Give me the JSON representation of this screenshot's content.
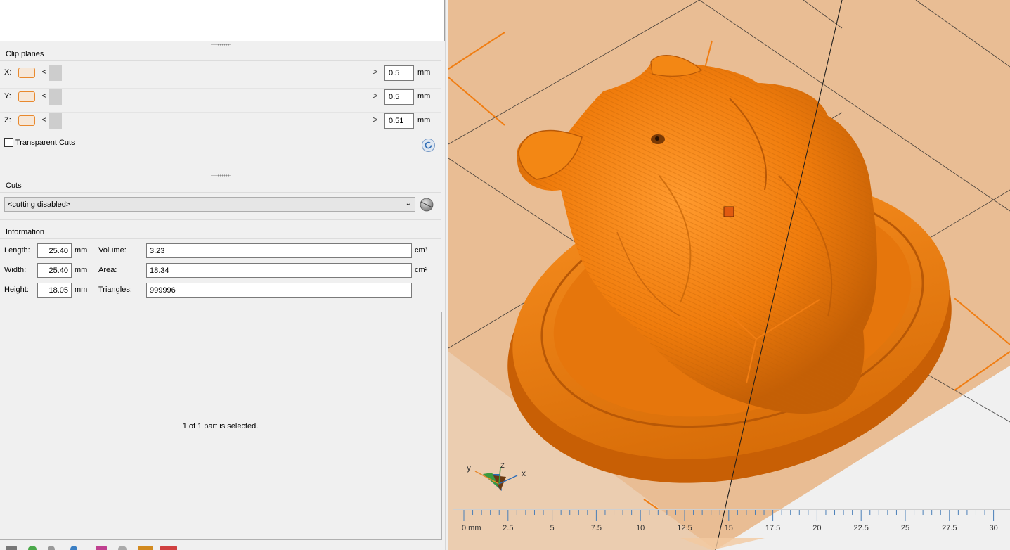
{
  "clip_planes": {
    "title": "Clip planes",
    "rows": [
      {
        "axis": "X:",
        "value": "0.5",
        "unit": "mm"
      },
      {
        "axis": "Y:",
        "value": "0.5",
        "unit": "mm"
      },
      {
        "axis": "Z:",
        "value": "0.51",
        "unit": "mm"
      }
    ],
    "arrow_left": "<",
    "arrow_right": ">",
    "transparent_cuts_label": "Transparent Cuts",
    "transparent_cuts_checked": false
  },
  "cuts": {
    "title": "Cuts",
    "selected": "<cutting disabled>"
  },
  "information": {
    "title": "Information",
    "length_label": "Length:",
    "length_value": "25.40",
    "length_unit": "mm",
    "width_label": "Width:",
    "width_value": "25.40",
    "width_unit": "mm",
    "height_label": "Height:",
    "height_value": "18.05",
    "height_unit": "mm",
    "volume_label": "Volume:",
    "volume_value": "3.23",
    "volume_unit": "cm³",
    "area_label": "Area:",
    "area_value": "18.34",
    "area_unit": "cm²",
    "triangles_label": "Triangles:",
    "triangles_value": "999996"
  },
  "status": {
    "selection_text": "1 of 1 part is selected."
  },
  "viewport": {
    "ruler_labels": [
      "0 mm",
      "2.5",
      "5",
      "7.5",
      "10",
      "12.5",
      "15",
      "17.5",
      "20",
      "22.5",
      "25",
      "27.5",
      "30"
    ],
    "axis_labels": {
      "x": "x",
      "y": "y",
      "z": "z"
    },
    "model_color": "#f4820f",
    "plate_color": "#e9bd94"
  },
  "colors": {
    "accent_orange": "#e8892e",
    "panel_bg": "#f0f0f0"
  }
}
